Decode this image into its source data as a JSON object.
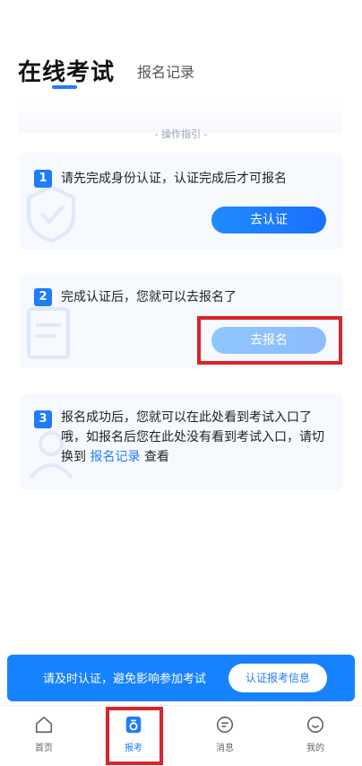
{
  "header": {
    "active_tab": "在线考试",
    "inactive_tab": "报名记录"
  },
  "guide": {
    "title": "- 操作指引 -",
    "steps": [
      {
        "number": "1",
        "text": "请先完成身份认证，认证完成后才可报名",
        "button": "去认证"
      },
      {
        "number": "2",
        "text": "完成认证后，您就可以去报名了",
        "button": "去报名"
      },
      {
        "number": "3",
        "text_before": "报名成功后，您就可以在此处看到考试入口了哦，如报名后您在此处没有看到考试入口，请切换到 ",
        "link": "报名记录",
        "text_after": " 查看"
      }
    ]
  },
  "notice": {
    "text": "请及时认证，避免影响参加考试",
    "button": "认证报考信息"
  },
  "tabbar": {
    "items": [
      {
        "label": "首页",
        "icon": "home-icon"
      },
      {
        "label": "报考",
        "icon": "exam-icon"
      },
      {
        "label": "消息",
        "icon": "message-icon"
      },
      {
        "label": "我的",
        "icon": "profile-icon"
      }
    ],
    "active_index": 1
  },
  "colors": {
    "accent": "#1f7cff",
    "highlight_box": "#d8242a",
    "card_bg": "#f6f9fe"
  }
}
